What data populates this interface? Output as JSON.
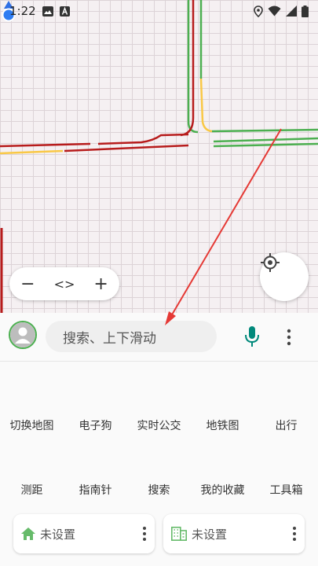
{
  "status_bar": {
    "time": "1:22"
  },
  "map": {
    "zoom_out_label": "−",
    "code_label": "<>",
    "zoom_in_label": "+"
  },
  "search": {
    "placeholder": "搜索、上下滑动"
  },
  "tools_row1": [
    {
      "label": "切换地图"
    },
    {
      "label": "电子狗"
    },
    {
      "label": "实时公交"
    },
    {
      "label": "地铁图"
    },
    {
      "label": "出行"
    }
  ],
  "tools_row2": [
    {
      "label": "测距"
    },
    {
      "label": "指南针"
    },
    {
      "label": "搜索"
    },
    {
      "label": "我的收藏"
    },
    {
      "label": "工具箱"
    }
  ],
  "shortcuts": {
    "home": {
      "label": "未设置",
      "icon": "home-icon"
    },
    "work": {
      "label": "未设置",
      "icon": "building-icon"
    }
  },
  "colors": {
    "accent": "#4caf50",
    "traffic_red": "#b71c1c",
    "traffic_green": "#4caf50",
    "traffic_yellow": "#f9c846",
    "annotation_arrow": "#e53935",
    "mic": "#00897b"
  }
}
